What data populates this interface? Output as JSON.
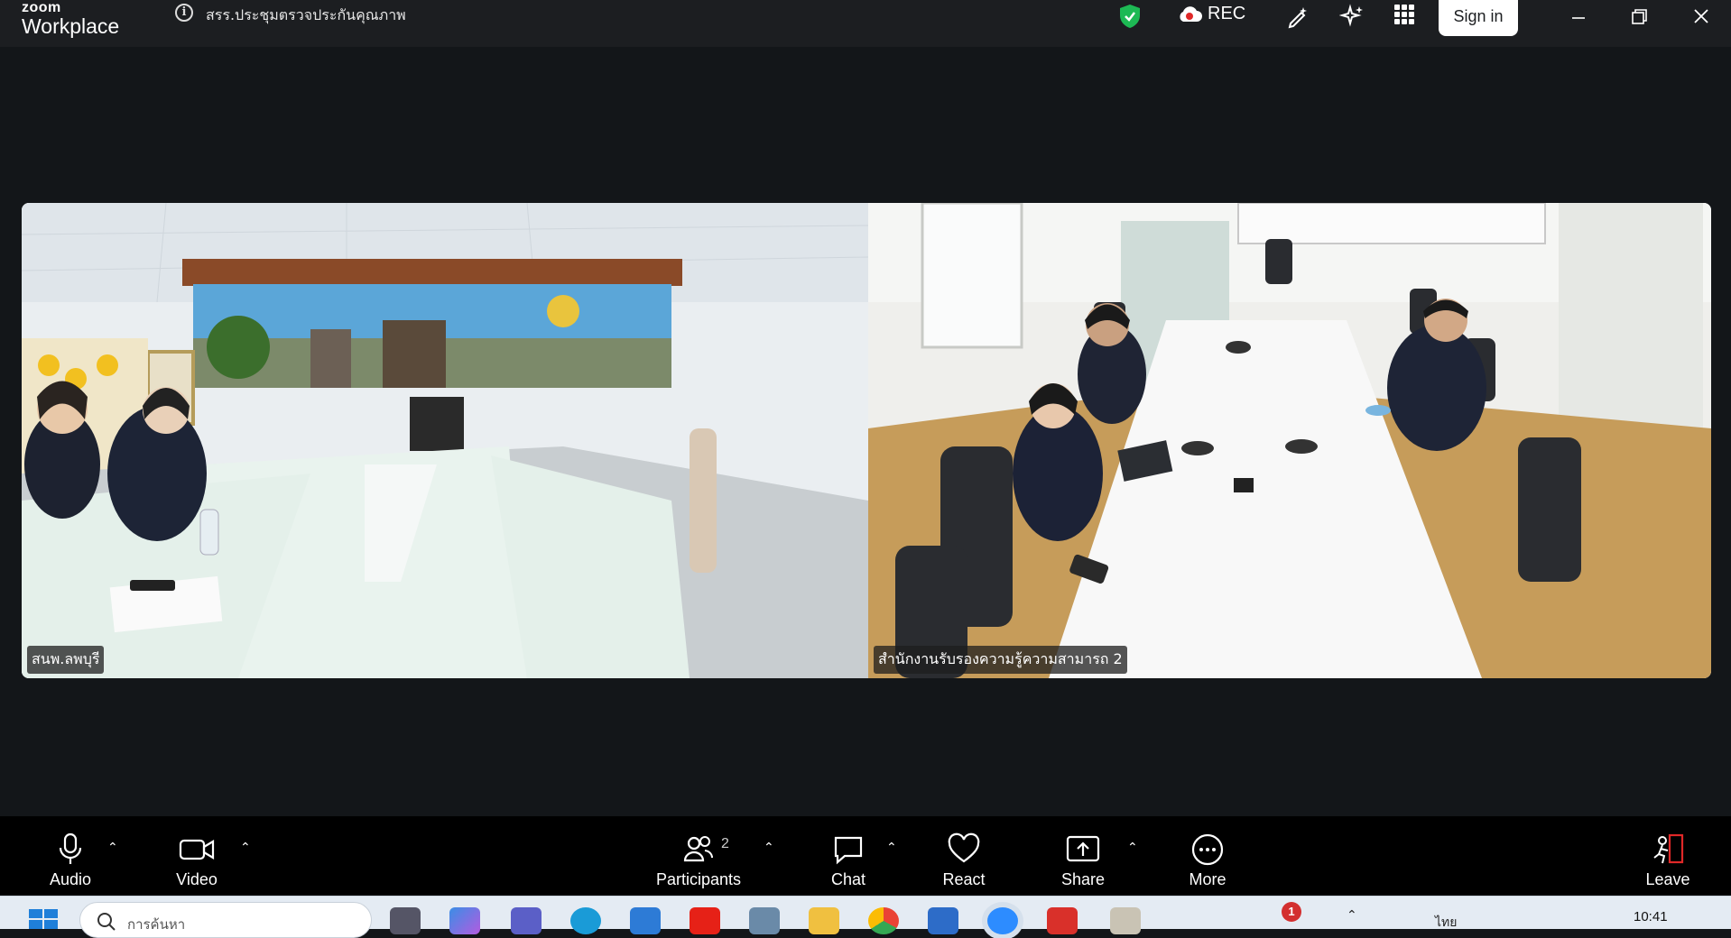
{
  "app": {
    "logo_top": "zoom",
    "logo_bottom": "Workplace",
    "meeting_title": "สรร.ประชุมตรวจประกันคุณภาพ",
    "rec_label": "REC",
    "signin_label": "Sign in"
  },
  "videos": [
    {
      "name": "สนพ.ลพบุรี"
    },
    {
      "name": "สำนักงานรับรองความรู้ความสามารถ 2"
    }
  ],
  "toolbar": {
    "audio": "Audio",
    "video": "Video",
    "participants": "Participants",
    "participants_count": "2",
    "chat": "Chat",
    "react": "React",
    "share": "Share",
    "more": "More",
    "leave": "Leave"
  },
  "taskbar": {
    "search_placeholder": "การค้นหา",
    "badge_count": "1",
    "language": "ไทย",
    "time": "10:41"
  },
  "colors": {
    "titlebar": "#1c1e21",
    "background": "#131619",
    "toolbar": "#000000",
    "leave_red": "#e02828",
    "shield_green": "#1db954"
  }
}
